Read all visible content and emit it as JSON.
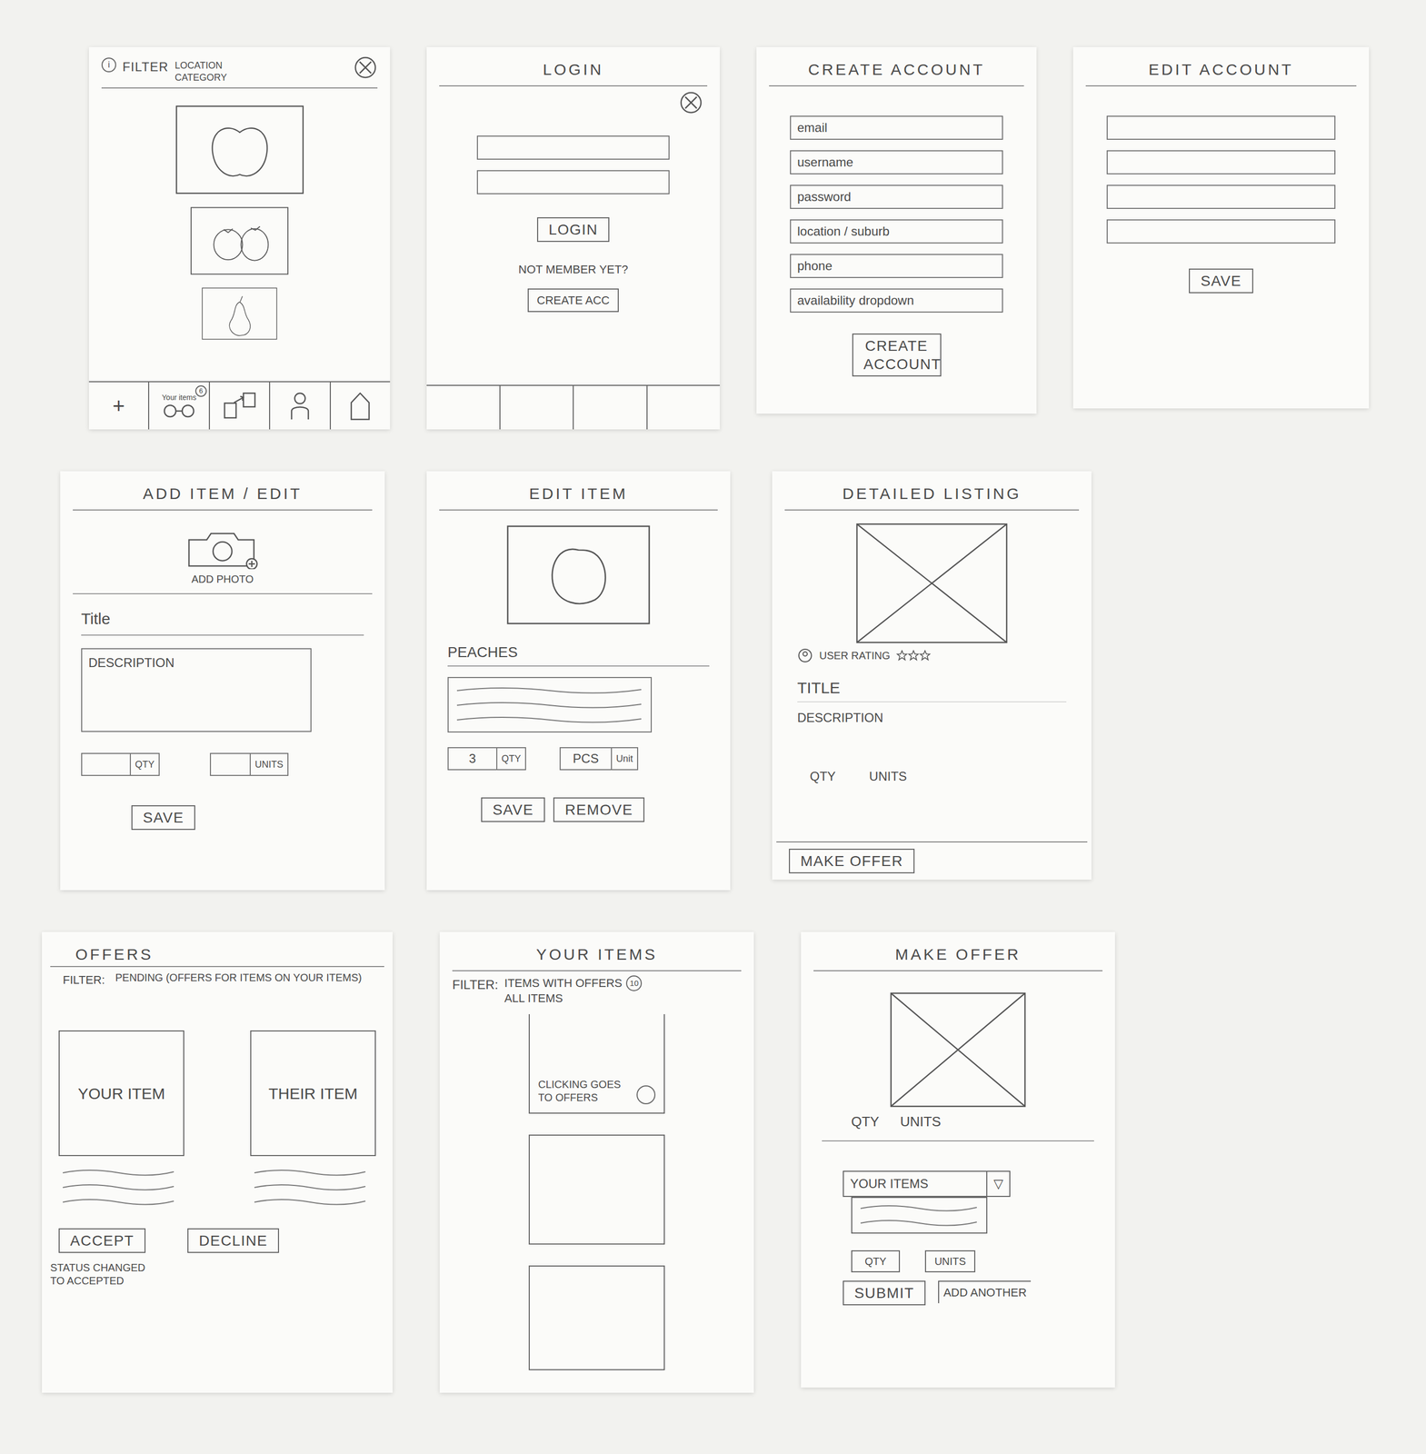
{
  "browse": {
    "info": "i",
    "filter_label": "FILTER",
    "filter_options": [
      "LOCATION",
      "CATEGORY"
    ],
    "tabbar": [
      {
        "kind": "add",
        "label": "+"
      },
      {
        "kind": "items",
        "label": "Your items",
        "badge": "6"
      },
      {
        "kind": "swap"
      },
      {
        "kind": "profile"
      },
      {
        "kind": "home"
      }
    ]
  },
  "login": {
    "title": "LOGIN",
    "fields": [
      "",
      ""
    ],
    "button": "LOGIN",
    "prompt": "NOT MEMBER YET?",
    "link": "CREATE ACC",
    "tabbar": [
      "",
      "",
      "",
      ""
    ]
  },
  "create_account": {
    "title": "CREATE ACCOUNT",
    "fields": [
      "email",
      "username",
      "password",
      "location / suburb",
      "phone",
      "availability dropdown"
    ],
    "button": "CREATE ACCOUNT"
  },
  "edit_account": {
    "title": "EDIT ACCOUNT",
    "fields": [
      "",
      "",
      "",
      ""
    ],
    "button": "SAVE"
  },
  "add_item": {
    "title": "ADD ITEM / EDIT",
    "photo_label": "ADD PHOTO",
    "title_label": "Title",
    "description_label": "DESCRIPTION",
    "qty": {
      "value": "",
      "label": "QTY"
    },
    "units": {
      "value": "",
      "label": "UNITS"
    },
    "button": "SAVE"
  },
  "edit_item": {
    "title": "EDIT ITEM",
    "name": "PEACHES",
    "qty": {
      "value": "3",
      "label": "QTY"
    },
    "units": {
      "value": "PCS",
      "label": "Unit"
    },
    "buttons": [
      "SAVE",
      "REMOVE"
    ]
  },
  "detailed_listing": {
    "title": "DETAILED LISTING",
    "rating_label": "USER RATING",
    "stars": 3,
    "title_label": "TITLE",
    "description_label": "DESCRIPTION",
    "qty_label": "QTY",
    "units_label": "UNITS",
    "button": "MAKE OFFER"
  },
  "offers": {
    "title": "OFFERS",
    "filter_label": "FILTER:",
    "filter_value": "PENDING (OFFERS FOR ITEMS ON YOUR ITEMS)",
    "cards": [
      "YOUR ITEM",
      "THEIR ITEM"
    ],
    "accept": "ACCEPT",
    "decline": "DECLINE",
    "note": "STATUS CHANGED TO ACCEPTED"
  },
  "your_items": {
    "title": "YOUR ITEMS",
    "filter_label": "FILTER:",
    "options": [
      {
        "label": "ITEMS WITH OFFERS",
        "badge": "10"
      },
      {
        "label": "ALL ITEMS"
      }
    ],
    "note": "CLICKING GOES TO OFFERS"
  },
  "make_offer": {
    "title": "MAKE OFFER",
    "qty_label": "QTY",
    "units_label": "UNITS",
    "dropdown": {
      "label": "YOUR ITEMS",
      "arrow": "▽"
    },
    "qty": "QTY",
    "units": "UNITS",
    "buttons": [
      "SUBMIT",
      "ADD ANOTHER"
    ]
  }
}
